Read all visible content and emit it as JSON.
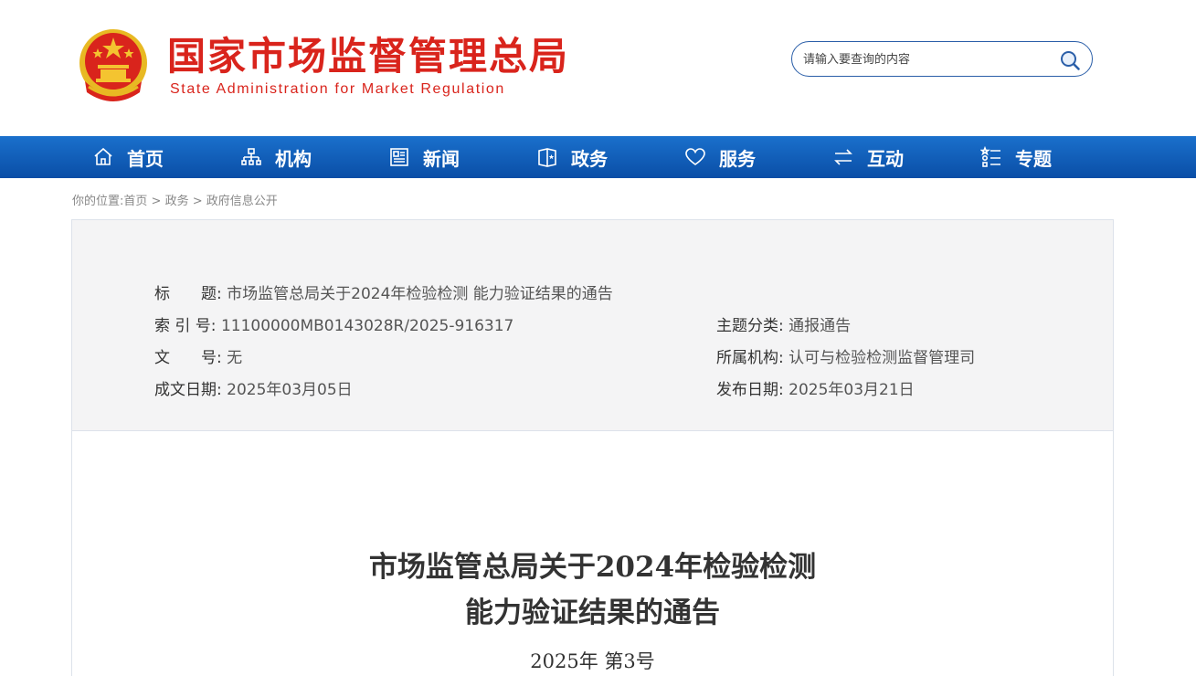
{
  "header": {
    "brand_cn": "国家市场监督管理总局",
    "brand_en": "State Administration for Market Regulation",
    "search_placeholder": "请输入要查询的内容"
  },
  "nav": {
    "items": [
      {
        "label": "首页",
        "icon": "home-icon"
      },
      {
        "label": "机构",
        "icon": "org-chart-icon"
      },
      {
        "label": "新闻",
        "icon": "newspaper-icon"
      },
      {
        "label": "政务",
        "icon": "book-icon"
      },
      {
        "label": "服务",
        "icon": "heart-icon"
      },
      {
        "label": "互动",
        "icon": "exchange-icon"
      },
      {
        "label": "专题",
        "icon": "list-icon"
      }
    ]
  },
  "breadcrumb": {
    "prefix": "你的位置:",
    "items": [
      "首页",
      "政务",
      "政府信息公开"
    ],
    "separator": ">"
  },
  "meta": {
    "title_label": "标　　题:",
    "title_value": "市场监管总局关于2024年检验检测 能力验证结果的通告",
    "index_label": "索 引 号:",
    "index_value": "11100000MB0143028R/2025-916317",
    "category_label": "主题分类:",
    "category_value": "通报通告",
    "docno_label": "文　　号:",
    "docno_value": "无",
    "org_label": "所属机构:",
    "org_value": "认可与检验检测监督管理司",
    "written_label": "成文日期:",
    "written_value": "2025年03月05日",
    "published_label": "发布日期:",
    "published_value": "2025年03月21日"
  },
  "document": {
    "title_line1": "市场监管总局关于2024年检验检测",
    "title_line2": "能力验证结果的通告",
    "number": "2025年 第3号"
  },
  "colors": {
    "brand_red": "#d9241c",
    "nav_blue": "#0a4ea6",
    "meta_bg": "#f4f4f5"
  }
}
